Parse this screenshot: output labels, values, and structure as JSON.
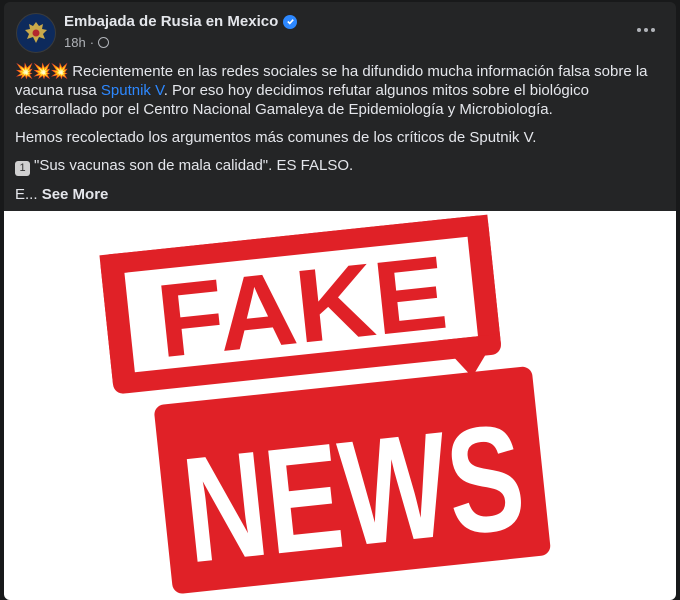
{
  "post": {
    "page_name": "Embajada de Rusia en Mexico",
    "time": "18h",
    "separator": "·",
    "intro_emoji": "💥💥💥",
    "text_1a": " Recientemente en las redes sociales se ha difundido mucha información falsa sobre la vacuna rusa ",
    "link_text": "Sputnik V",
    "text_1b": ". Por eso hoy decidimos refutar algunos mitos sobre el biológico desarrollado por el Centro Nacional Gamaleya de Epidemiología y Microbiología.",
    "text_2": "Hemos recolectado los argumentos más comunes de los críticos de Sputnik V.",
    "number_badge": "1",
    "text_3": "\"Sus vacunas son de mala calidad\". ES FALSO.",
    "truncated": "E...",
    "see_more": "See More"
  },
  "image": {
    "word_1": "FAKE",
    "word_2": "NEWS",
    "stamp_color": "#e02127"
  },
  "colors": {
    "link": "#2d88ff",
    "card": "#242526",
    "verified": "#2d88ff"
  },
  "icons": {
    "verified": "verified-badge-icon",
    "privacy": "globe-icon",
    "menu": "more-options-icon"
  }
}
